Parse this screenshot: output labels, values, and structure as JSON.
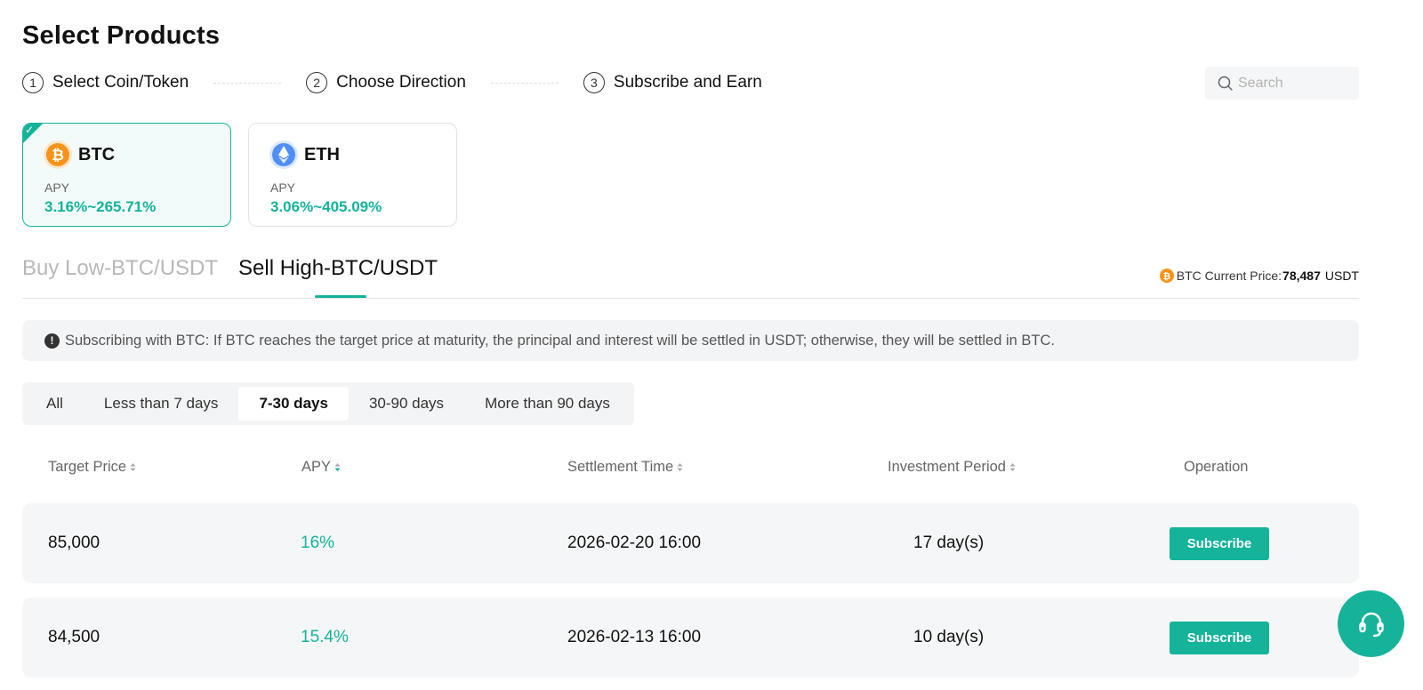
{
  "page": {
    "title": "Select Products"
  },
  "steps": [
    {
      "num": "1",
      "label": "Select Coin/Token"
    },
    {
      "num": "2",
      "label": "Choose Direction"
    },
    {
      "num": "3",
      "label": "Subscribe and Earn"
    }
  ],
  "search": {
    "placeholder": "Search",
    "value": ""
  },
  "coins": [
    {
      "symbol": "BTC",
      "apy_label": "APY",
      "apy_value": "3.16%~265.71%",
      "selected": true,
      "icon": "btc-icon"
    },
    {
      "symbol": "ETH",
      "apy_label": "APY",
      "apy_value": "3.06%~405.09%",
      "selected": false,
      "icon": "eth-icon"
    }
  ],
  "direction_tabs": [
    {
      "label": "Buy Low-BTC/USDT",
      "active": false
    },
    {
      "label": "Sell High-BTC/USDT",
      "active": true
    }
  ],
  "price_info": {
    "label": "BTC Current Price:",
    "value": "78,487",
    "unit": "USDT"
  },
  "notice": {
    "text": "Subscribing with BTC: If BTC reaches the target price at maturity, the principal and interest will be settled in USDT; otherwise, they will be settled in BTC."
  },
  "filters": [
    {
      "label": "All",
      "active": false
    },
    {
      "label": "Less than 7 days",
      "active": false
    },
    {
      "label": "7-30 days",
      "active": true
    },
    {
      "label": "30-90 days",
      "active": false
    },
    {
      "label": "More than 90 days",
      "active": false
    }
  ],
  "table": {
    "headers": {
      "target_price": "Target Price",
      "apy": "APY",
      "settlement_time": "Settlement Time",
      "investment_period": "Investment Period",
      "operation": "Operation"
    },
    "rows": [
      {
        "target_price": "85,000",
        "apy": "16%",
        "settlement_time": "2026-02-20 16:00",
        "investment_period": "17 day(s)",
        "action": "Subscribe"
      },
      {
        "target_price": "84,500",
        "apy": "15.4%",
        "settlement_time": "2026-02-13 16:00",
        "investment_period": "10 day(s)",
        "action": "Subscribe"
      }
    ]
  },
  "colors": {
    "accent": "#14b39a",
    "btc": "#f7931a",
    "eth": "#4f8ef7"
  },
  "support": {
    "icon": "headset-icon"
  }
}
